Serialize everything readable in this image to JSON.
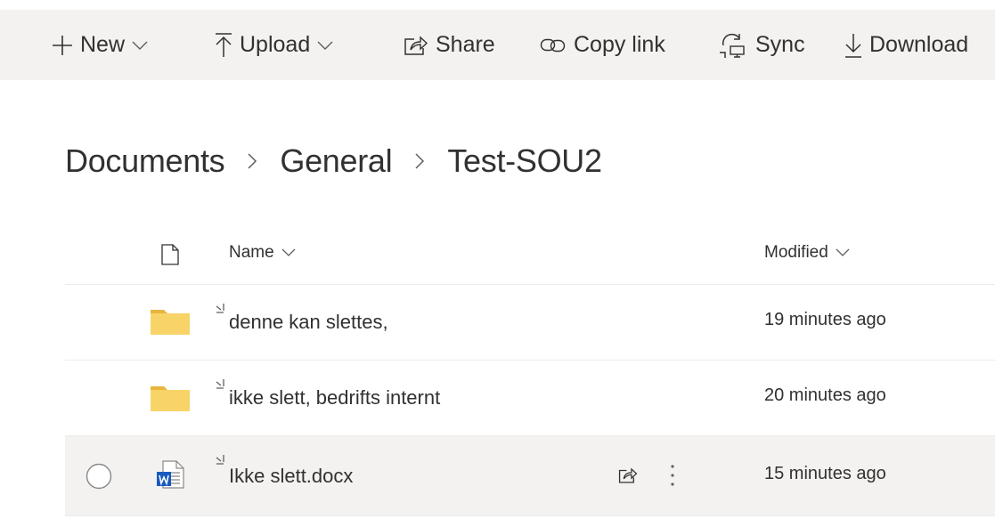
{
  "toolbar": {
    "new_label": "New",
    "upload_label": "Upload",
    "share_label": "Share",
    "copy_link_label": "Copy link",
    "sync_label": "Sync",
    "download_label": "Download"
  },
  "breadcrumb": {
    "items": [
      "Documents",
      "General",
      "Test-SOU2"
    ]
  },
  "list": {
    "columns": {
      "name": "Name",
      "modified": "Modified"
    },
    "rows": [
      {
        "name": "denne kan slettes,",
        "modified": "19 minutes ago",
        "type": "folder-icon"
      },
      {
        "name": "ikke slett, bedrifts internt",
        "modified": "20 minutes ago",
        "type": "folder-icon"
      },
      {
        "name": "Ikke slett.docx",
        "modified": "15 minutes ago",
        "type": "word-document-icon"
      }
    ]
  },
  "colors": {
    "toolbar_bg": "#f3f2f1",
    "selected_row_bg": "#f3f2f1",
    "folder": "#f8d367",
    "word_blue": "#185abd",
    "text": "#323130"
  }
}
